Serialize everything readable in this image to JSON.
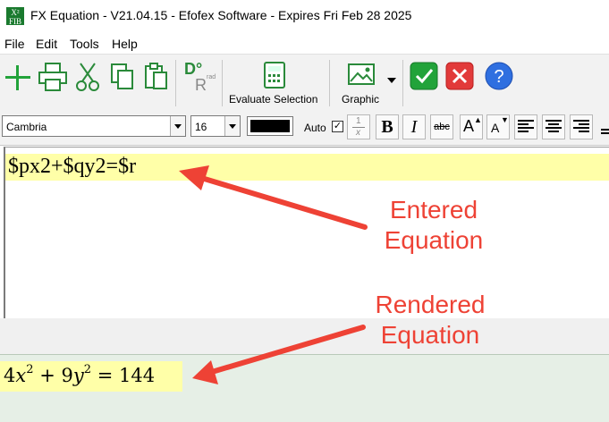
{
  "window": {
    "title": "FX Equation - V21.04.15 - Efofex Software - Expires Fri Feb 28 2025",
    "app_icon_label": "X² FIB"
  },
  "menu": [
    "File",
    "Edit",
    "Tools",
    "Help"
  ],
  "toolbar": {
    "evaluate_label": "Evaluate Selection",
    "graphic_label": "Graphic",
    "rad_label": "rad",
    "accent_green": "#22a33a",
    "accent_red": "#e23a3a",
    "accent_blue": "#2f6fe0"
  },
  "format": {
    "font": "Cambria",
    "size": "16",
    "auto_label": "Auto",
    "auto_checked": true,
    "fraction_num": "1",
    "fraction_den": "x",
    "bold": "B",
    "italic": "I",
    "strike": "abc"
  },
  "editor": {
    "text": "$px2+$qy2=$r",
    "highlight": "#ffffa8"
  },
  "rendered": {
    "c1": "4",
    "v1": "x",
    "e1": "2",
    "plus": "+",
    "c2": "9",
    "v2": "y",
    "e2": "2",
    "eq": "=",
    "rhs": "144",
    "background": "#e6efe6"
  },
  "annotations": {
    "entered": "Entered\nEquation",
    "rendered": "Rendered\nEquation",
    "color": "#ee4235"
  }
}
